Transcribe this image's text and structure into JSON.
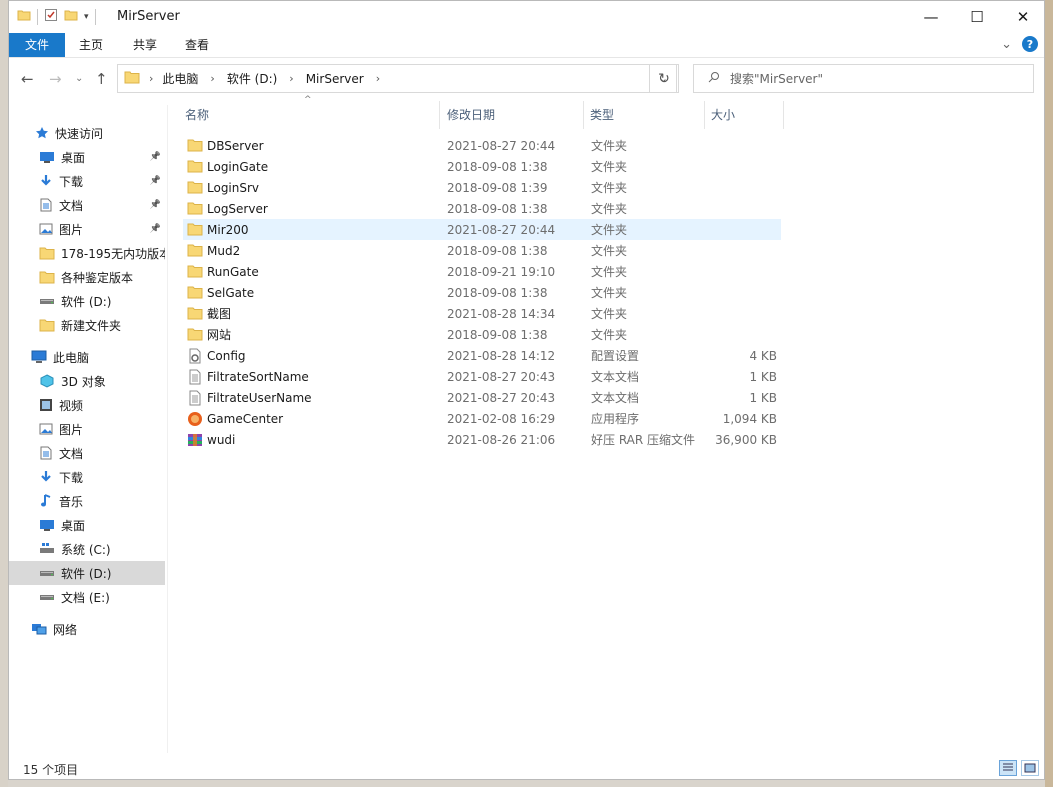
{
  "window": {
    "title": "MirServer",
    "minimize_glyph": "—",
    "maximize_glyph": "☐",
    "close_glyph": "✕"
  },
  "ribbon": {
    "tabs": [
      "文件",
      "主页",
      "共享",
      "查看"
    ],
    "expand_glyph": "⌄",
    "help_glyph": "?"
  },
  "nav": {
    "back_glyph": "←",
    "forward_glyph": "→",
    "recent_glyph": "⌄",
    "up_glyph": "↑",
    "breadcrumb": [
      "此电脑",
      "软件 (D:)",
      "MirServer"
    ],
    "refresh_glyph": "↻",
    "search_placeholder": "搜索\"MirServer\""
  },
  "navpane": {
    "items": [
      {
        "label": "快速访问",
        "icon": "star-icon",
        "pinned": false
      },
      {
        "label": "桌面",
        "icon": "desktop-icon",
        "pinned": true
      },
      {
        "label": "下载",
        "icon": "download-icon",
        "pinned": true
      },
      {
        "label": "文档",
        "icon": "document-icon",
        "pinned": true
      },
      {
        "label": "图片",
        "icon": "picture-icon",
        "pinned": true
      },
      {
        "label": "178-195无内功版本",
        "icon": "folder-icon",
        "pinned": false
      },
      {
        "label": "各种鉴定版本",
        "icon": "folder-icon",
        "pinned": false
      },
      {
        "label": "软件 (D:)",
        "icon": "drive-icon",
        "pinned": false
      },
      {
        "label": "新建文件夹",
        "icon": "folder-icon",
        "pinned": false
      },
      {
        "label": "此电脑",
        "icon": "computer-icon",
        "pinned": false
      },
      {
        "label": "3D 对象",
        "icon": "cube-icon",
        "pinned": false
      },
      {
        "label": "视频",
        "icon": "video-icon",
        "pinned": false
      },
      {
        "label": "图片",
        "icon": "picture-icon",
        "pinned": false
      },
      {
        "label": "文档",
        "icon": "document-icon",
        "pinned": false
      },
      {
        "label": "下载",
        "icon": "download-icon",
        "pinned": false
      },
      {
        "label": "音乐",
        "icon": "music-icon",
        "pinned": false
      },
      {
        "label": "桌面",
        "icon": "desktop-icon",
        "pinned": false
      },
      {
        "label": "系统 (C:)",
        "icon": "system-drive-icon",
        "pinned": false
      },
      {
        "label": "软件 (D:)",
        "icon": "drive-icon",
        "pinned": false,
        "selected": true
      },
      {
        "label": "文档 (E:)",
        "icon": "drive-icon",
        "pinned": false
      },
      {
        "label": "网络",
        "icon": "network-icon",
        "pinned": false
      }
    ]
  },
  "columns": {
    "name": "名称",
    "date": "修改日期",
    "type": "类型",
    "size": "大小"
  },
  "files": [
    {
      "name": "DBServer",
      "date": "2021-08-27 20:44",
      "type": "文件夹",
      "size": "",
      "icon": "folder-icon"
    },
    {
      "name": "LoginGate",
      "date": "2018-09-08 1:38",
      "type": "文件夹",
      "size": "",
      "icon": "folder-icon"
    },
    {
      "name": "LoginSrv",
      "date": "2018-09-08 1:39",
      "type": "文件夹",
      "size": "",
      "icon": "folder-icon"
    },
    {
      "name": "LogServer",
      "date": "2018-09-08 1:38",
      "type": "文件夹",
      "size": "",
      "icon": "folder-icon"
    },
    {
      "name": "Mir200",
      "date": "2021-08-27 20:44",
      "type": "文件夹",
      "size": "",
      "icon": "folder-icon",
      "hover": true
    },
    {
      "name": "Mud2",
      "date": "2018-09-08 1:38",
      "type": "文件夹",
      "size": "",
      "icon": "folder-icon"
    },
    {
      "name": "RunGate",
      "date": "2018-09-21 19:10",
      "type": "文件夹",
      "size": "",
      "icon": "folder-icon"
    },
    {
      "name": "SelGate",
      "date": "2018-09-08 1:38",
      "type": "文件夹",
      "size": "",
      "icon": "folder-icon"
    },
    {
      "name": "截图",
      "date": "2021-08-28 14:34",
      "type": "文件夹",
      "size": "",
      "icon": "folder-icon"
    },
    {
      "name": "网站",
      "date": "2018-09-08 1:38",
      "type": "文件夹",
      "size": "",
      "icon": "folder-icon"
    },
    {
      "name": "Config",
      "date": "2021-08-28 14:12",
      "type": "配置设置",
      "size": "4 KB",
      "icon": "config-file-icon"
    },
    {
      "name": "FiltrateSortName",
      "date": "2021-08-27 20:43",
      "type": "文本文档",
      "size": "1 KB",
      "icon": "text-file-icon"
    },
    {
      "name": "FiltrateUserName",
      "date": "2021-08-27 20:43",
      "type": "文本文档",
      "size": "1 KB",
      "icon": "text-file-icon"
    },
    {
      "name": "GameCenter",
      "date": "2021-02-08 16:29",
      "type": "应用程序",
      "size": "1,094 KB",
      "icon": "app-icon"
    },
    {
      "name": "wudi",
      "date": "2021-08-26 21:06",
      "type": "好压 RAR 压缩文件",
      "size": "36,900 KB",
      "icon": "archive-icon"
    }
  ],
  "status": {
    "count": "15 个项目"
  },
  "colors": {
    "accent": "#1979ca",
    "folder": "#f8d775",
    "hover_row": "#e5f3ff",
    "selected_nav": "#d9d9d9"
  }
}
